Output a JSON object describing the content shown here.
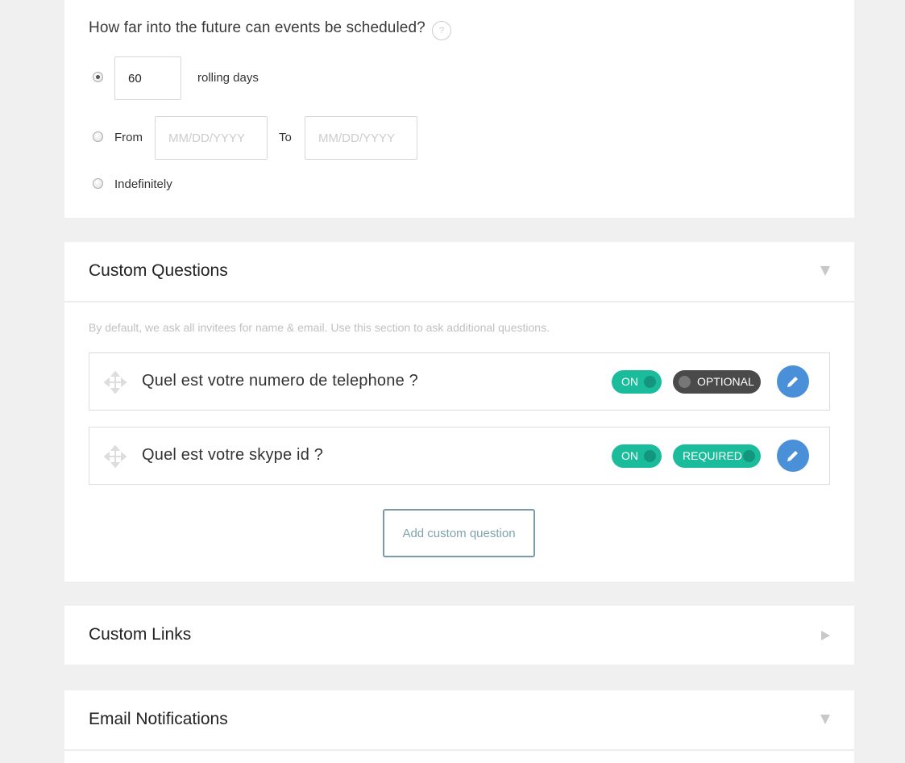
{
  "schedule": {
    "question": "How far into the future can events be scheduled?",
    "help_icon": "?",
    "options": [
      {
        "id": "rolling",
        "selected": true,
        "value": "60",
        "suffix": "rolling days"
      },
      {
        "id": "range",
        "selected": false,
        "from_label": "From",
        "from_placeholder": "MM/DD/YYYY",
        "to_label": "To",
        "to_placeholder": "MM/DD/YYYY"
      },
      {
        "id": "indefinitely",
        "selected": false,
        "label": "Indefinitely"
      }
    ]
  },
  "custom_questions": {
    "title": "Custom Questions",
    "expanded": true,
    "hint": "By default, we ask all invitees for name & email. Use this section to ask additional questions.",
    "items": [
      {
        "text": "Quel est votre numero de telephone ?",
        "status": "ON",
        "requirement": "OPTIONAL",
        "icons": [
          "drag-handle-icon",
          "pencil-icon"
        ]
      },
      {
        "text": "Quel est votre skype id ?",
        "status": "ON",
        "requirement": "REQUIRED",
        "icons": [
          "drag-handle-icon",
          "pencil-icon"
        ]
      }
    ],
    "add_button": "Add custom question"
  },
  "custom_links": {
    "title": "Custom Links",
    "expanded": false
  },
  "email_notifications": {
    "title": "Email Notifications",
    "expanded": true
  },
  "colors": {
    "accent_green": "#1abc9c",
    "dark_toggle": "#4a4a4a",
    "edit_blue": "#4a90d9",
    "page_bg": "#f0f0f0"
  }
}
